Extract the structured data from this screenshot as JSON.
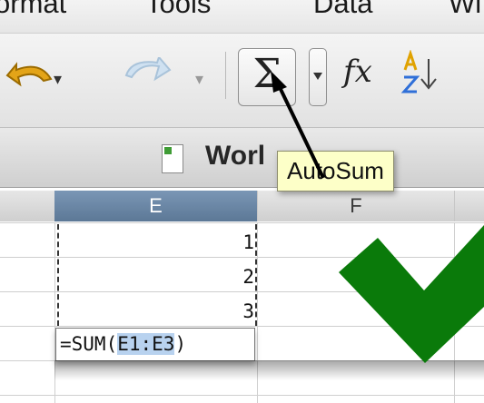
{
  "menu": {
    "items": [
      "ormat",
      "Tools",
      "Data",
      "Wi"
    ]
  },
  "toolbar": {
    "sum_glyph": "Σ",
    "fx_glyph": "fx"
  },
  "window": {
    "title": "Worl"
  },
  "tooltip": {
    "text": "AutoSum"
  },
  "grid": {
    "columns": [
      "E",
      "F"
    ],
    "values": [
      "1",
      "2",
      "3"
    ],
    "formula_prefix": "=SUM(",
    "formula_ref": "E1:E3",
    "formula_suffix": ")"
  },
  "colors": {
    "selected_header": "#6b87a6",
    "tooltip_bg": "#fdffc8",
    "checkmark": "#0a7a0a",
    "ref_highlight": "#b8d2ef"
  },
  "icons": [
    "undo-icon",
    "redo-icon",
    "autosum-icon",
    "function-icon",
    "sort-az-icon",
    "checkmark-icon",
    "arrow-annotation-icon",
    "document-icon"
  ]
}
